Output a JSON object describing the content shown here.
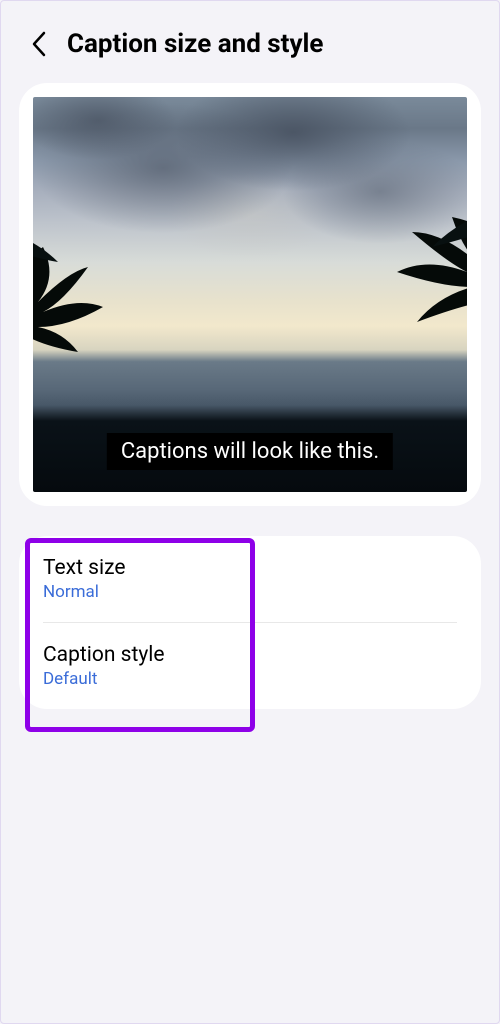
{
  "header": {
    "title": "Caption size and style"
  },
  "preview": {
    "caption_text": "Captions will look like this."
  },
  "settings": {
    "text_size": {
      "label": "Text size",
      "value": "Normal"
    },
    "caption_style": {
      "label": "Caption style",
      "value": "Default"
    }
  }
}
